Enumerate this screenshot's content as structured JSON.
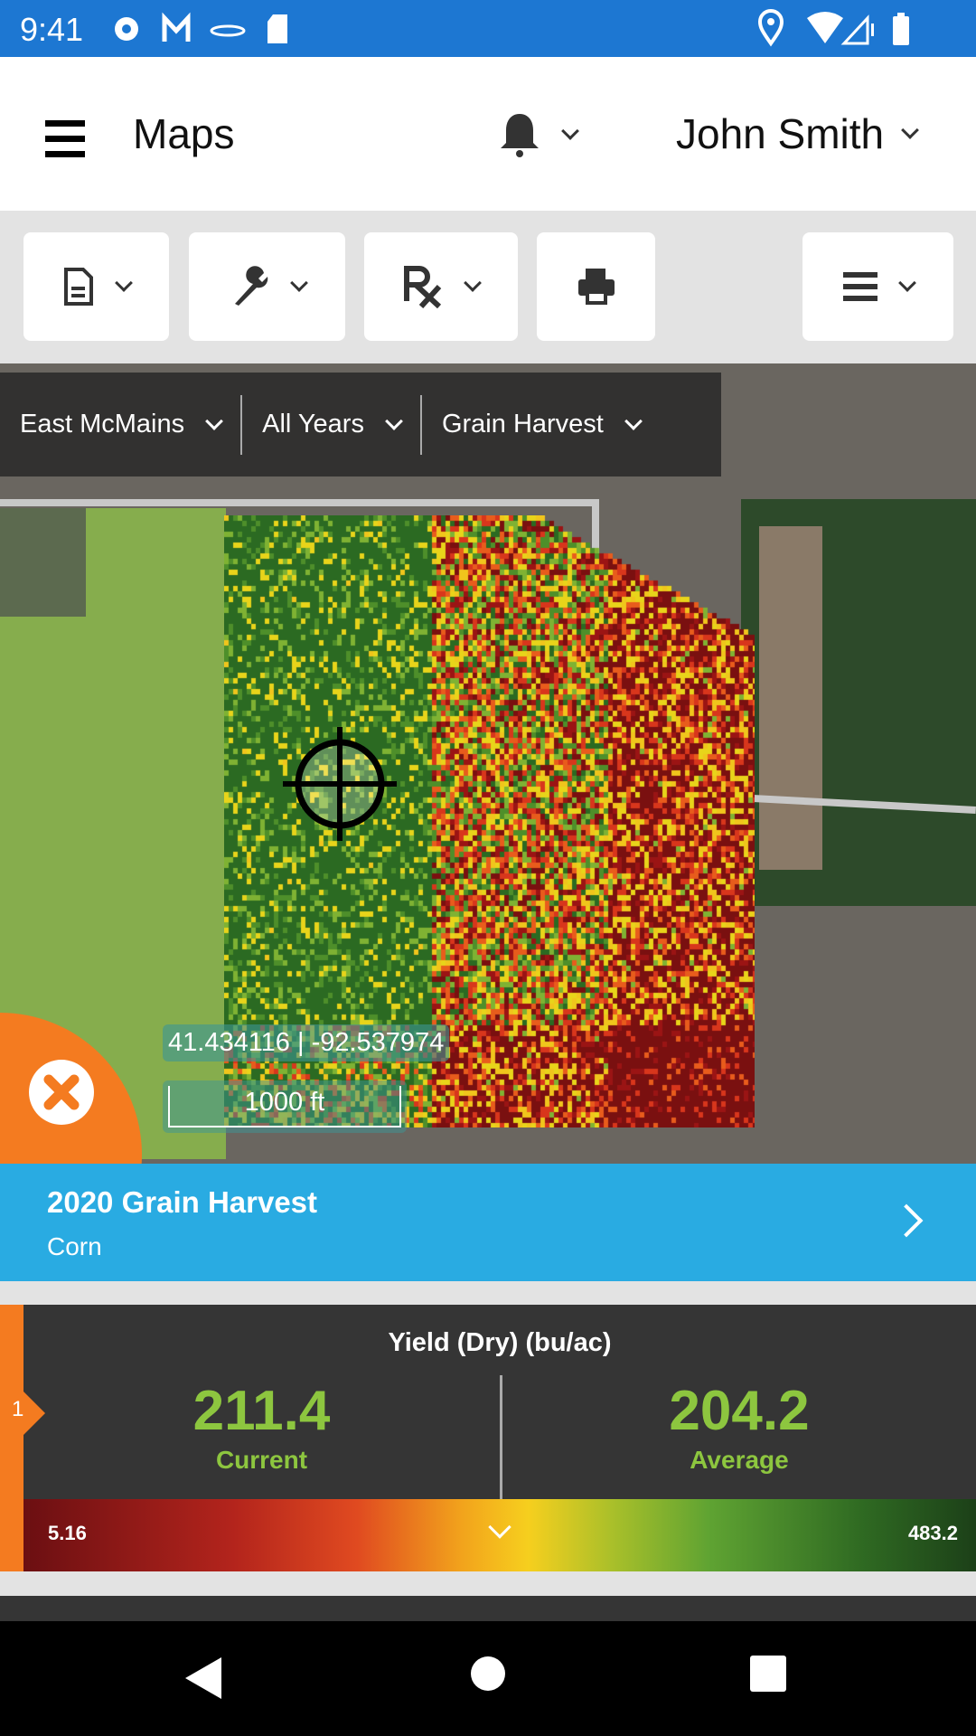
{
  "status_bar": {
    "time": "9:41",
    "icons": [
      "gear-icon",
      "gmail-icon",
      "app-icon",
      "sd-card-icon",
      "location-icon",
      "wifi-icon",
      "signal-icon",
      "battery-icon"
    ]
  },
  "header": {
    "title": "Maps",
    "user": "John Smith"
  },
  "toolbar": {
    "buttons": [
      "document-icon",
      "wrench-icon",
      "rx-icon",
      "print-icon",
      "list-icon"
    ]
  },
  "map": {
    "filters": [
      {
        "label": "East McMains"
      },
      {
        "label": "All Years"
      },
      {
        "label": "Grain Harvest"
      }
    ],
    "coordinates": "41.434116 | -92.537974",
    "scale": "1000 ft"
  },
  "banner": {
    "title": "2020 Grain Harvest",
    "subtitle": "Corn"
  },
  "legend": {
    "index": "1",
    "title": "Yield (Dry) (bu/ac)",
    "current_value": "211.4",
    "current_label": "Current",
    "average_value": "204.2",
    "average_label": "Average",
    "min": "5.16",
    "max": "483.2",
    "colors": {
      "accent": "#f47b20",
      "value": "#8dc63f",
      "banner": "#29abe2"
    }
  }
}
